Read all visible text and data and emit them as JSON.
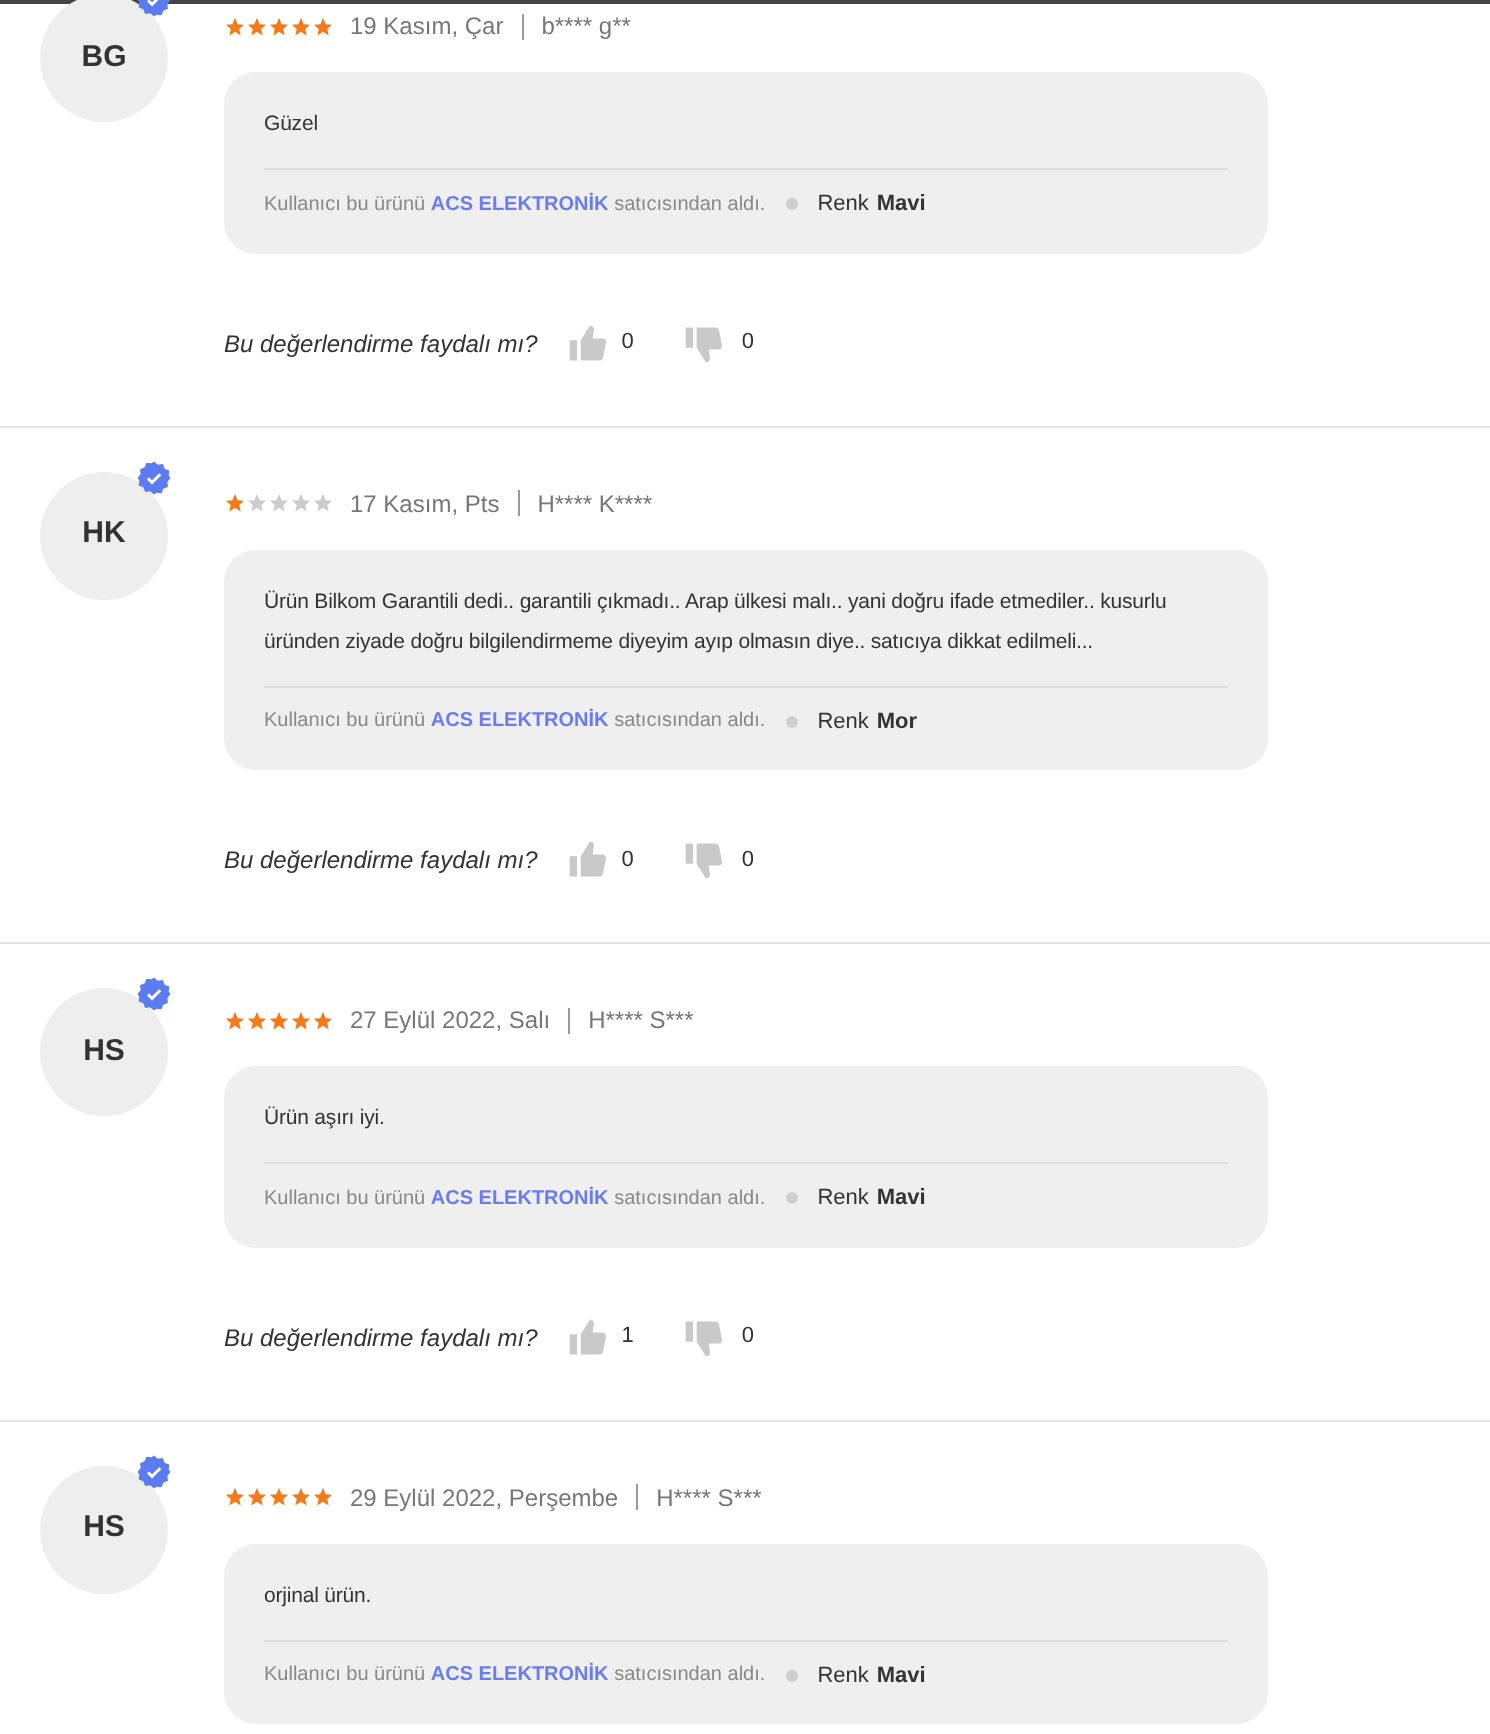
{
  "reviews": [
    {
      "initials": "BG",
      "verified": true,
      "stars": 5,
      "date": "19 Kasım, Çar",
      "author": "b**** g**",
      "text": "Güzel",
      "note_before": "Kullanıcı bu ürünü",
      "seller": "ACS ELEKTRONİK",
      "note_after": "satıcısından aldı.",
      "attr_label": "Renk",
      "attr_value": "Mavi",
      "feedback": {
        "question": "Bu değerlendirme faydalı mı?",
        "likes": "0",
        "dislikes": "0"
      }
    },
    {
      "initials": "HK",
      "verified": true,
      "stars": 1,
      "date": "17 Kasım, Pts",
      "author": "H**** K****",
      "text": "Ürün Bilkom Garantili dedi.. garantili çıkmadı.. Arap ülkesi malı.. yani doğru ifade etmediler.. kusurlu üründen ziyade doğru bilgilendirmeme diyeyim ayıp olmasın diye.. satıcıya dikkat edilmeli...",
      "note_before": "Kullanıcı bu ürünü",
      "seller": "ACS ELEKTRONİK",
      "note_after": "satıcısından aldı.",
      "attr_label": "Renk",
      "attr_value": "Mor",
      "feedback": {
        "question": "Bu değerlendirme faydalı mı?",
        "likes": "0",
        "dislikes": "0"
      }
    },
    {
      "initials": "HS",
      "verified": true,
      "stars": 5,
      "date": "27 Eylül 2022, Salı",
      "author": "H**** S***",
      "text": "Ürün aşırı iyi.",
      "note_before": "Kullanıcı bu ürünü",
      "seller": "ACS ELEKTRONİK",
      "note_after": "satıcısından aldı.",
      "attr_label": "Renk",
      "attr_value": "Mavi",
      "feedback": {
        "question": "Bu değerlendirme faydalı mı?",
        "likes": "1",
        "dislikes": "0"
      }
    },
    {
      "initials": "HS",
      "verified": true,
      "stars": 5,
      "date": "29 Eylül 2022, Perşembe",
      "author": "H**** S***",
      "text": "orjinal ürün.",
      "note_before": "Kullanıcı bu ürünü",
      "seller": "ACS ELEKTRONİK",
      "note_after": "satıcısından aldı.",
      "attr_label": "Renk",
      "attr_value": "Mavi"
    }
  ]
}
